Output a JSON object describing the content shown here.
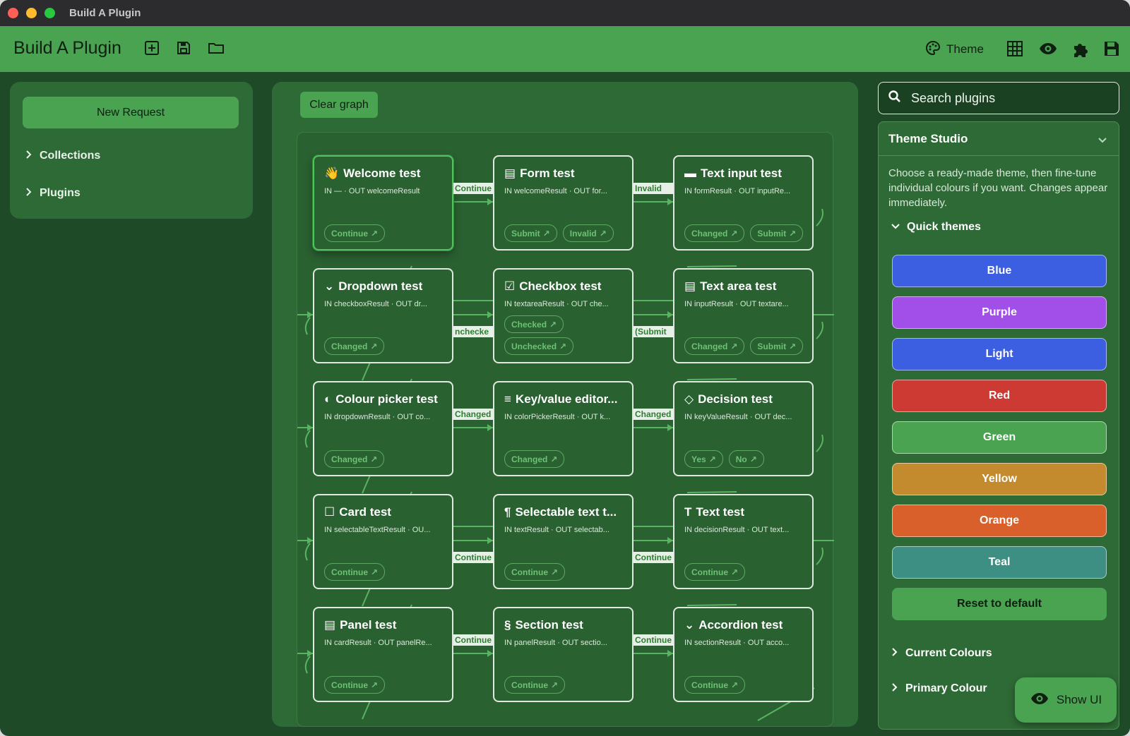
{
  "window": {
    "title": "Build A Plugin"
  },
  "header": {
    "title": "Build A Plugin",
    "theme_label": "Theme",
    "icons": [
      "new-plugin-icon",
      "save-icon",
      "open-folder-icon",
      "palette-icon",
      "grid-icon",
      "eye-icon",
      "puzzle-icon",
      "save-icon"
    ]
  },
  "sidebar": {
    "new_request": "New Request",
    "items": [
      {
        "label": "Collections"
      },
      {
        "label": "Plugins"
      }
    ]
  },
  "graph": {
    "clear_label": "Clear graph",
    "nodes": [
      {
        "icon": "👋",
        "title": "Welcome test",
        "io": "IN —  ·  OUT welcomeResult",
        "chips": [
          [
            "Continue"
          ]
        ],
        "selected": true
      },
      {
        "icon": "▤",
        "title": "Form test",
        "io": "IN welcomeResult  ·  OUT for...",
        "chips": [
          [
            "Submit",
            "Invalid"
          ]
        ]
      },
      {
        "icon": "▬",
        "title": "Text input test",
        "io": "IN formResult  ·  OUT inputRe...",
        "chips": [
          [
            "Changed",
            "Submit"
          ]
        ]
      },
      {
        "icon": "⌄",
        "title": "Dropdown test",
        "io": "IN checkboxResult  ·  OUT dr...",
        "chips": [
          [
            "Changed"
          ]
        ]
      },
      {
        "icon": "☑",
        "title": "Checkbox test",
        "io": "IN textareaResult  ·  OUT che...",
        "chips": [
          [
            "Checked"
          ],
          [
            "Unchecked"
          ]
        ]
      },
      {
        "icon": "▤",
        "title": "Text area test",
        "io": "IN inputResult  ·  OUT textare...",
        "chips": [
          [
            "Changed",
            "Submit"
          ]
        ]
      },
      {
        "icon": "◐",
        "title": "Colour picker test",
        "io": "IN dropdownResult  ·  OUT co...",
        "chips": [
          [
            "Changed"
          ]
        ]
      },
      {
        "icon": "≡",
        "title": "Key/value editor...",
        "io": "IN colorPickerResult  ·  OUT k...",
        "chips": [
          [
            "Changed"
          ]
        ]
      },
      {
        "icon": "◇",
        "title": "Decision test",
        "io": "IN keyValueResult  ·  OUT dec...",
        "chips": [
          [
            "Yes",
            "No"
          ]
        ]
      },
      {
        "icon": "☐",
        "title": "Card test",
        "io": "IN selectableTextResult  ·  OU...",
        "chips": [
          [
            "Continue"
          ]
        ]
      },
      {
        "icon": "¶",
        "title": "Selectable text t...",
        "io": "IN textResult  ·  OUT selectab...",
        "chips": [
          [
            "Continue"
          ]
        ]
      },
      {
        "icon": "T",
        "title": "Text test",
        "io": "IN decisionResult  ·  OUT text...",
        "chips": [
          [
            "Continue"
          ]
        ]
      },
      {
        "icon": "▤",
        "title": "Panel test",
        "io": "IN cardResult  ·  OUT panelRe...",
        "chips": [
          [
            "Continue"
          ]
        ]
      },
      {
        "icon": "§",
        "title": "Section test",
        "io": "IN panelResult  ·  OUT sectio...",
        "chips": [
          [
            "Continue"
          ]
        ]
      },
      {
        "icon": "⌄",
        "title": "Accordion test",
        "io": "IN sectionResult  ·  OUT acco...",
        "chips": [
          [
            "Continue"
          ]
        ]
      }
    ],
    "edge_labels": [
      "Continue",
      "Invalid",
      "nchecke",
      "(Submit",
      "Changed",
      "Changed",
      "Continue",
      "Continue",
      "Continue",
      "Continue"
    ]
  },
  "search": {
    "placeholder": "Search plugins"
  },
  "studio": {
    "title": "Theme Studio",
    "description": "Choose a ready-made theme, then fine-tune individual colours if you want. Changes appear immediately.",
    "quick_themes_label": "Quick themes",
    "themes": [
      {
        "label": "Blue",
        "color": "#3b5fe0"
      },
      {
        "label": "Purple",
        "color": "#a24ee8"
      },
      {
        "label": "Light",
        "color": "#3b5fe0"
      },
      {
        "label": "Red",
        "color": "#cc3a33"
      },
      {
        "label": "Green",
        "color": "#4aa351"
      },
      {
        "label": "Yellow",
        "color": "#c48a2e"
      },
      {
        "label": "Orange",
        "color": "#d9602a"
      },
      {
        "label": "Teal",
        "color": "#3d8f84"
      },
      {
        "label": "Reset to default",
        "color": "#4aa351"
      }
    ],
    "current_colours_label": "Current Colours",
    "primary_colour_label": "Primary Colour"
  },
  "show_ui": {
    "label": "Show UI"
  }
}
